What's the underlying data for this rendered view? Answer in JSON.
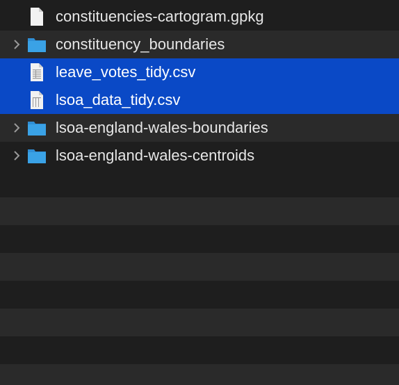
{
  "colors": {
    "background": "#1e1e1e",
    "row_alt": "#2a2a2a",
    "selection": "#0a49c6",
    "folder": "#3aa2e6",
    "text": "#e6e6e6"
  },
  "files": [
    {
      "name": "constituencies-cartogram.gpkg",
      "kind": "document",
      "icon": "document-icon",
      "expandable": false,
      "selected": false
    },
    {
      "name": "constituency_boundaries",
      "kind": "folder",
      "icon": "folder-icon",
      "expandable": true,
      "selected": false
    },
    {
      "name": "leave_votes_tidy.csv",
      "kind": "csv",
      "icon": "csv-file-icon",
      "expandable": false,
      "selected": true
    },
    {
      "name": "lsoa_data_tidy.csv",
      "kind": "csv",
      "icon": "csv-file-icon",
      "expandable": false,
      "selected": true
    },
    {
      "name": "lsoa-england-wales-boundaries",
      "kind": "folder",
      "icon": "folder-icon",
      "expandable": true,
      "selected": false
    },
    {
      "name": "lsoa-england-wales-centroids",
      "kind": "folder",
      "icon": "folder-icon",
      "expandable": true,
      "selected": false
    }
  ]
}
